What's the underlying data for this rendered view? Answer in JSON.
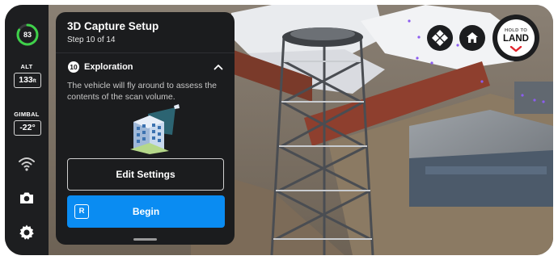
{
  "status": {
    "battery_percent": 83,
    "battery_label": "83",
    "altitude_label": "ALT",
    "altitude_value": "133",
    "altitude_unit": "ft",
    "gimbal_label": "GIMBAL",
    "gimbal_value": "-22°"
  },
  "rail_icons": [
    "wifi-signal-icon",
    "camera-icon",
    "gear-icon"
  ],
  "panel": {
    "title": "3D Capture Setup",
    "step": "Step 10 of 14",
    "step_number": "10",
    "section_title": "Exploration",
    "description": "The vehicle will fly around to assess the contents of the scan volume.",
    "edit_button": "Edit Settings",
    "begin_key": "R",
    "begin_button": "Begin"
  },
  "controls": {
    "land_top": "HOLD TO",
    "land_main": "LAND"
  },
  "colors": {
    "accent_blue": "#0a8cf2",
    "battery_green": "#3fd14a",
    "land_red": "#e0242c",
    "panel_bg": "#1b1c1e",
    "rail_bg": "#1d1e20"
  }
}
